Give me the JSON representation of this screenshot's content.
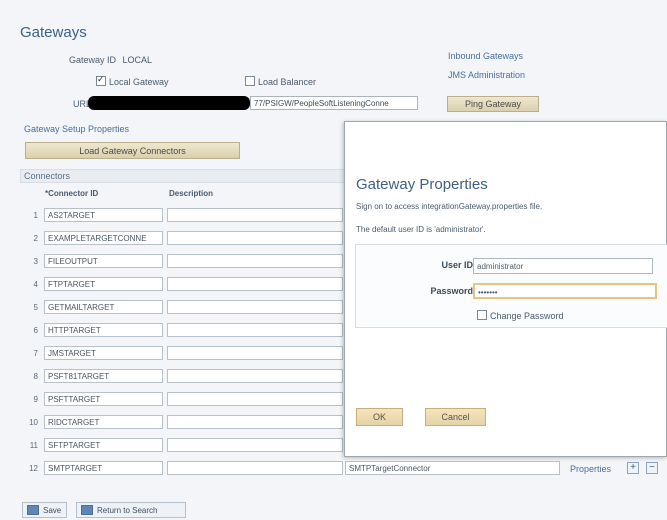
{
  "page": {
    "title": "Gateways",
    "gateway_id_label": "Gateway ID",
    "gateway_id_value": "LOCAL",
    "local_gateway_label": "Local Gateway",
    "load_balancer_label": "Load Balancer",
    "url_label": "URL",
    "url_value": "77/PSIGW/PeopleSoftListeningConne",
    "inbound_gateways": "Inbound Gateways",
    "jms_administration": "JMS Administration",
    "ping_gateway": "Ping Gateway",
    "gateway_setup_properties": "Gateway Setup Properties",
    "load_gateway_connectors": "Load Gateway Connectors"
  },
  "connectors": {
    "title": "Connectors",
    "connector_id_header": "*Connector ID",
    "description_header": "Description",
    "rows": [
      {
        "num": "1",
        "id": "AS2TARGET"
      },
      {
        "num": "2",
        "id": "EXAMPLETARGETCONNE"
      },
      {
        "num": "3",
        "id": "FILEOUTPUT"
      },
      {
        "num": "4",
        "id": "FTPTARGET"
      },
      {
        "num": "5",
        "id": "GETMAILTARGET"
      },
      {
        "num": "6",
        "id": "HTTPTARGET"
      },
      {
        "num": "7",
        "id": "JMSTARGET"
      },
      {
        "num": "8",
        "id": "PSFT81TARGET"
      },
      {
        "num": "9",
        "id": "PSFTTARGET"
      },
      {
        "num": "10",
        "id": "RIDCTARGET"
      },
      {
        "num": "11",
        "id": "SFTPTARGET"
      },
      {
        "num": "12",
        "id": "SMTPTARGET"
      }
    ],
    "last_row_connector_name": "SMTPTargetConnector",
    "properties_link": "Properties",
    "add_button": "+",
    "remove_button": "−"
  },
  "bottom": {
    "save": "Save",
    "return_to_search": "Return to Search"
  },
  "modal": {
    "title": "Gateway Properties",
    "line1": "Sign on to access integrationGateway.properties file.",
    "line2": "The default user ID is 'administrator'.",
    "user_id_label": "User ID",
    "user_id_value": "administrator",
    "password_label": "Password",
    "password_value": "•••••••",
    "change_password_label": "Change Password",
    "ok_label": "OK",
    "cancel_label": "Cancel"
  },
  "colors": {
    "title_blue": "#3e5f8c",
    "link_blue": "#4a6f9f",
    "button_tan": "#e6d7b2",
    "focus_orange": "#e9c37f"
  }
}
